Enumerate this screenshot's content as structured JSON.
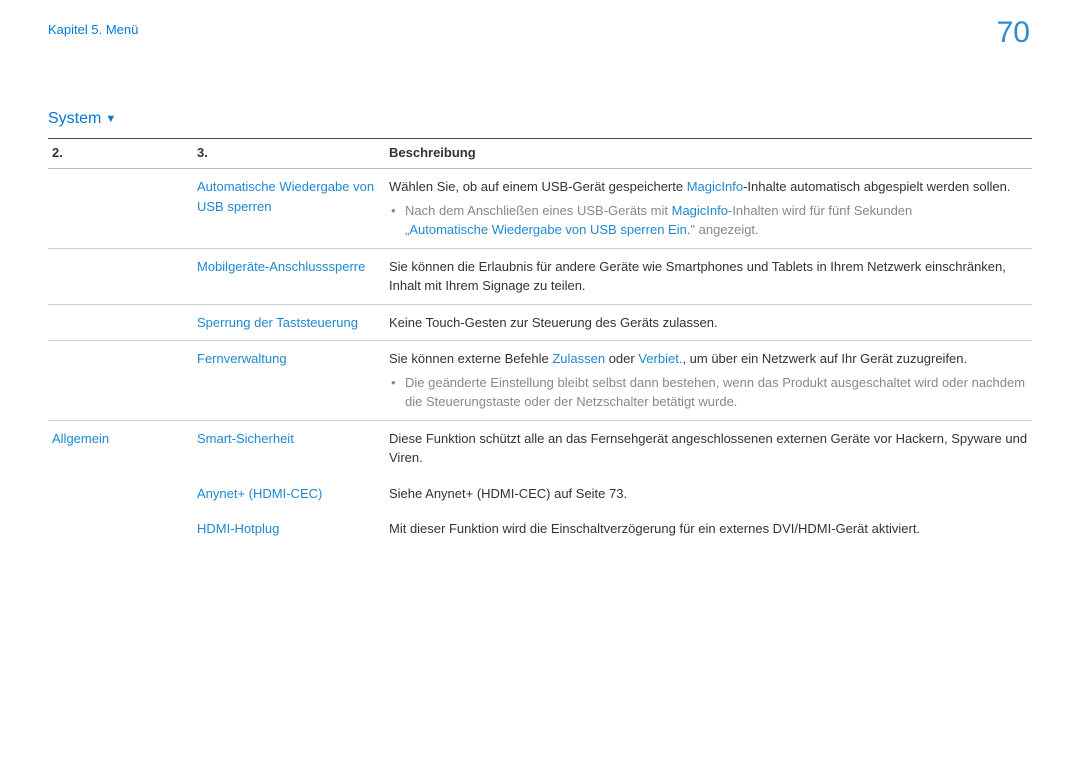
{
  "chapter": "Kapitel 5. Menü",
  "pageNumber": "70",
  "sectionTitle": "System",
  "headers": {
    "c1": "2.",
    "c2": "3.",
    "c3": "Beschreibung"
  },
  "rows": {
    "r0": {
      "c2": "Automatische Wiedergabe von USB sperren",
      "c3a": "Wählen Sie, ob auf einem USB-Gerät gespeicherte ",
      "c3_mi": "MagicInfo",
      "c3b": "-Inhalte automatisch abgespielt werden sollen.",
      "bp1a": "Nach dem Anschließen eines USB-Geräts mit ",
      "bp1_mi": "MagicInfo",
      "bp1b": "-Inhalten wird für fünf Sekunden ",
      "bp1c_open": "„",
      "bp1c": "Automatische Wiedergabe von USB sperren Ein.",
      "bp1d": "\" angezeigt."
    },
    "r1": {
      "c2": "Mobilgeräte-Anschlusssperre",
      "c3": "Sie können die Erlaubnis für andere Geräte wie Smartphones und Tablets in Ihrem Netzwerk einschränken, Inhalt mit Ihrem Signage zu teilen."
    },
    "r2": {
      "c2": "Sperrung der Taststeuerung",
      "c3": "Keine Touch-Gesten zur Steuerung des Geräts zulassen."
    },
    "r3": {
      "c2": "Fernverwaltung",
      "c3a": "Sie können externe Befehle ",
      "c3_allow": "Zulassen",
      "c3b": " oder  ",
      "c3_deny": "Verbiet.",
      "c3c": ", um über ein Netzwerk auf Ihr Gerät zuzugreifen.",
      "bp1": "Die geänderte Einstellung bleibt selbst dann bestehen, wenn das Produkt ausgeschaltet wird oder nachdem die Steuerungstaste oder der Netzschalter betätigt wurde."
    },
    "r4": {
      "c1": "Allgemein",
      "c2": "Smart-Sicherheit",
      "c3": "Diese Funktion schützt alle an das Fernsehgerät angeschlossenen externen Geräte vor Hackern, Spyware und Viren."
    },
    "r5": {
      "c2": "Anynet+ (HDMI-CEC)",
      "c3": "Siehe Anynet+ (HDMI-CEC) auf Seite 73."
    },
    "r6": {
      "c2": "HDMI-Hotplug",
      "c3": "Mit dieser Funktion wird die Einschaltverzögerung für ein externes DVI/HDMI-Gerät aktiviert."
    }
  }
}
